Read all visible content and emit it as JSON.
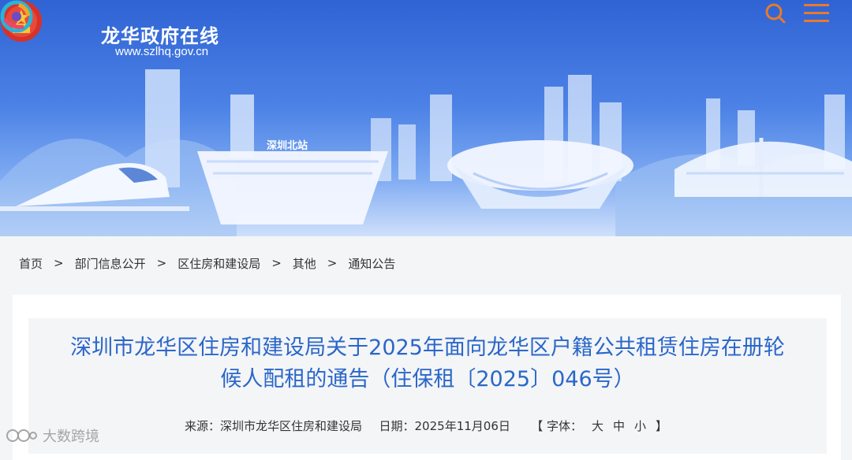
{
  "header": {
    "site_name": "龙华政府在线",
    "site_url": "www.szlhq.gov.cn",
    "station_label": "深圳北站",
    "search_icon": "search-icon",
    "menu_icon": "menu-icon",
    "colors": {
      "accent": "#e87a2a",
      "banner": "#4c82e6"
    }
  },
  "breadcrumb": {
    "items": [
      "首页",
      "部门信息公开",
      "区住房和建设局",
      "其他",
      "通知公告"
    ],
    "separator": ">"
  },
  "article": {
    "title_line1": "深圳市龙华区住房和建设局关于2025年面向龙华区户籍公共租赁住房在册轮",
    "title_line2": "候人配租的通告（住保租〔2025〕046号）",
    "source_label": "来源：深圳市龙华区住房和建设局",
    "date_label": "日期：2025年11月06日",
    "font_open": "【 字体：",
    "font_large": "大",
    "font_medium": "中",
    "font_small": "小",
    "font_close": "】"
  },
  "watermark": {
    "text": "大数跨境"
  }
}
